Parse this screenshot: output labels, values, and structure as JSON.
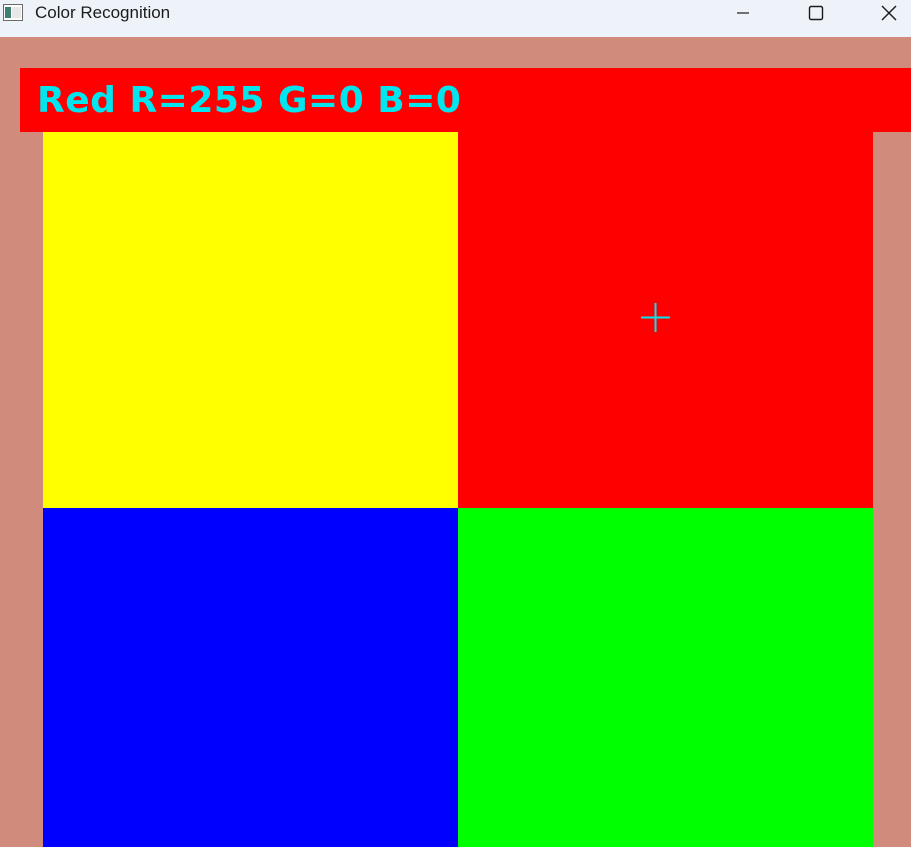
{
  "window": {
    "title": "Color Recognition"
  },
  "icons": {
    "app": "app-window-icon",
    "minimize": "minimize-icon",
    "maximize": "maximize-icon",
    "close": "close-icon",
    "crosshair": "crosshair-icon"
  },
  "detection": {
    "label": "Red R=255 G=0 B=0",
    "color_name": "Red",
    "r": 255,
    "g": 0,
    "b": 0
  },
  "colors": {
    "titlebar_bg": "#eef2f9",
    "canvas_bg": "#d08b7d",
    "label_bg": "#ff0000",
    "label_text": "#00e5ee",
    "crosshair": "#00e5ee",
    "quadrants": {
      "top_left": "#ffff00",
      "top_right": "#ff0000",
      "bottom_left": "#0000ff",
      "bottom_right": "#00ff00"
    }
  }
}
